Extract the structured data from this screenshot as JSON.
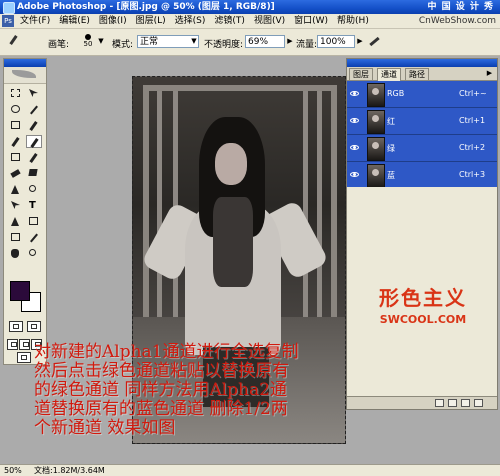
{
  "titlebar": {
    "title": "Adobe Photoshop - [原图.jpg @ 50% (图层 1, RGB/8)]",
    "watermark": "中 国 设 计 秀"
  },
  "menubar": {
    "items": [
      "文件(F)",
      "编辑(E)",
      "图像(I)",
      "图层(L)",
      "选择(S)",
      "滤镜(T)",
      "视图(V)",
      "窗口(W)",
      "帮助(H)"
    ],
    "watermark": "CnWebShow.com"
  },
  "options": {
    "brush_label": "画笔:",
    "brush_size": "50",
    "mode_label": "模式:",
    "mode_value": "正常",
    "opacity_label": "不透明度:",
    "opacity_value": "69%",
    "flow_label": "流量:",
    "flow_value": "100%"
  },
  "channels_palette": {
    "tabs": [
      "图层",
      "通道",
      "路径"
    ],
    "active_tab": "通道",
    "channels": [
      {
        "name": "RGB",
        "shortcut": "Ctrl+~"
      },
      {
        "name": "红",
        "shortcut": "Ctrl+1"
      },
      {
        "name": "绿",
        "shortcut": "Ctrl+2"
      },
      {
        "name": "蓝",
        "shortcut": "Ctrl+3"
      }
    ],
    "logo_main": "形色主义",
    "logo_sub": "SWCOOL.COM"
  },
  "status": {
    "zoom": "50%",
    "doc_size": "文档:1.82M/3.64M"
  },
  "caption": {
    "lines": [
      "对新建的Alpha1通道进行全选复制",
      "然后点击绿色通道粘贴以替换原有",
      "的绿色通道 同样方法用Alpha2通",
      "道替换原有的蓝色通道 删除1/2两",
      "个新通道 效果如图"
    ]
  },
  "colors": {
    "title_blue": "#1450c8",
    "selected_row": "#2e58c6",
    "caption_red": "#d11a0e",
    "foreground": "#2b0a3a",
    "background": "#ffffff"
  }
}
